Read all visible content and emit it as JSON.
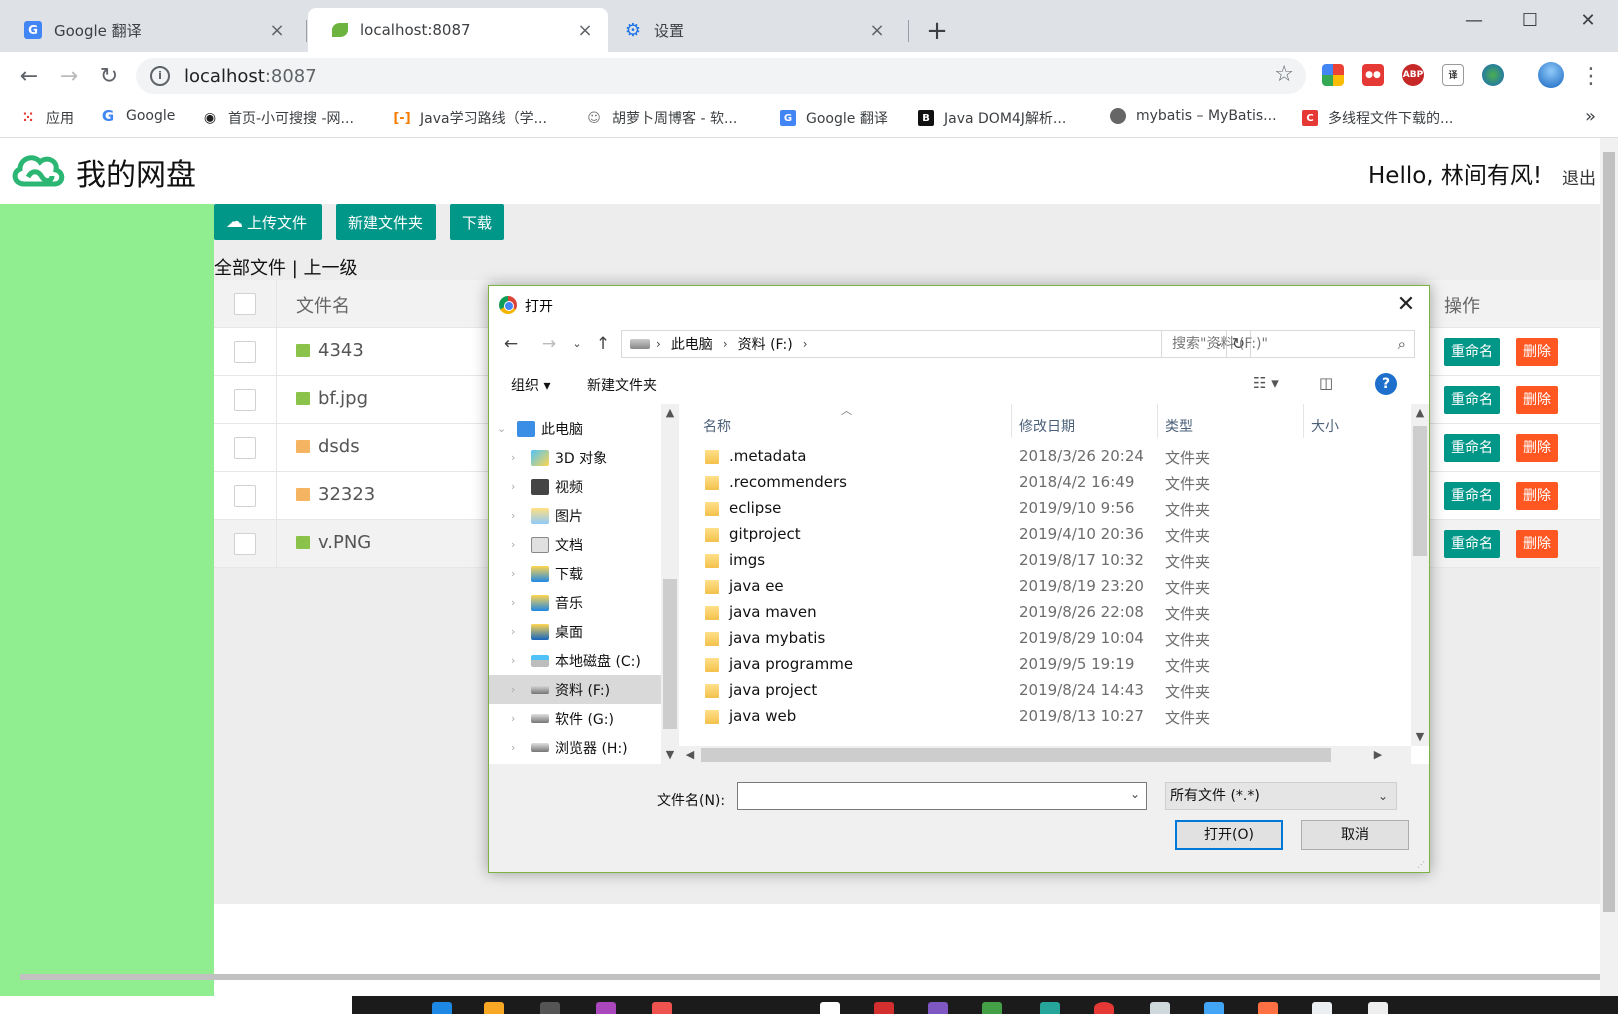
{
  "browser": {
    "tabs": [
      {
        "label": "Google 翻译",
        "icon": "google-translate-icon"
      },
      {
        "label": "localhost:8087",
        "icon": "spring-leaf-icon"
      },
      {
        "label": "设置",
        "icon": "gear-icon"
      }
    ],
    "url_host": "localhost",
    "url_port": ":8087",
    "bookmarks": [
      "应用",
      "Google",
      "首页-小可搜搜 -网...",
      "Java学习路线（学...",
      "胡萝卜周博客 - 软...",
      "Google 翻译",
      "Java DOM4J解析...",
      "mybatis – MyBatis...",
      "多线程文件下载的..."
    ],
    "extensions": [
      "ABP"
    ]
  },
  "page": {
    "site_title": "我的网盘",
    "greeting": "Hello, 林间有风!",
    "logout": "退出",
    "buttons": {
      "upload": "上传文件",
      "new_folder": "新建文件夹",
      "download": "下载"
    },
    "breadcrumb": "全部文件 | 上一级",
    "table": {
      "col_name": "文件名",
      "col_ops": "操作",
      "rename": "重命名",
      "delete": "删除",
      "rows": [
        {
          "name": "4343",
          "kind": "image"
        },
        {
          "name": "bf.jpg",
          "kind": "image"
        },
        {
          "name": "dsds",
          "kind": "folder"
        },
        {
          "name": "32323",
          "kind": "folder"
        },
        {
          "name": "v.PNG",
          "kind": "image"
        }
      ]
    },
    "colors": {
      "sidebar": "#90ee90",
      "primary": "#009688",
      "danger": "#ff5722"
    }
  },
  "dialog": {
    "title": "打开",
    "path": [
      "此电脑",
      "资料 (F:)"
    ],
    "search_placeholder": "搜索\"资料 (F:)\"",
    "organize": "组织 ▾",
    "new_folder": "新建文件夹",
    "nav": [
      {
        "label": "此电脑",
        "icon": "pc-icon"
      },
      {
        "label": "3D 对象",
        "icon": "3d-objects-icon"
      },
      {
        "label": "视频",
        "icon": "video-folder-icon"
      },
      {
        "label": "图片",
        "icon": "pictures-folder-icon"
      },
      {
        "label": "文档",
        "icon": "documents-folder-icon"
      },
      {
        "label": "下载",
        "icon": "downloads-folder-icon"
      },
      {
        "label": "音乐",
        "icon": "music-folder-icon"
      },
      {
        "label": "桌面",
        "icon": "desktop-folder-icon"
      },
      {
        "label": "本地磁盘 (C:)",
        "icon": "system-drive-icon"
      },
      {
        "label": "资料 (F:)",
        "icon": "drive-icon",
        "selected": true
      },
      {
        "label": "软件 (G:)",
        "icon": "drive-icon"
      },
      {
        "label": "浏览器 (H:)",
        "icon": "drive-icon"
      }
    ],
    "columns": {
      "name": "名称",
      "date": "修改日期",
      "type": "类型",
      "size": "大小"
    },
    "files": [
      {
        "name": ".metadata",
        "date": "2018/3/26 20:24",
        "type": "文件夹"
      },
      {
        "name": ".recommenders",
        "date": "2018/4/2 16:49",
        "type": "文件夹"
      },
      {
        "name": "eclipse",
        "date": "2019/9/10 9:56",
        "type": "文件夹"
      },
      {
        "name": "gitproject",
        "date": "2019/4/10 20:36",
        "type": "文件夹"
      },
      {
        "name": "imgs",
        "date": "2019/8/17 10:32",
        "type": "文件夹"
      },
      {
        "name": "java ee",
        "date": "2019/8/19 23:20",
        "type": "文件夹"
      },
      {
        "name": "java maven",
        "date": "2019/8/26 22:08",
        "type": "文件夹"
      },
      {
        "name": "java mybatis",
        "date": "2019/8/29 10:04",
        "type": "文件夹"
      },
      {
        "name": "java programme",
        "date": "2019/9/5 19:19",
        "type": "文件夹"
      },
      {
        "name": "java project",
        "date": "2019/8/24 14:43",
        "type": "文件夹"
      },
      {
        "name": "java web",
        "date": "2019/8/13 10:27",
        "type": "文件夹"
      }
    ],
    "filename_label": "文件名(N):",
    "filename_value": "",
    "filetype": "所有文件 (*.*)",
    "open_button": "打开(O)",
    "cancel_button": "取消"
  }
}
